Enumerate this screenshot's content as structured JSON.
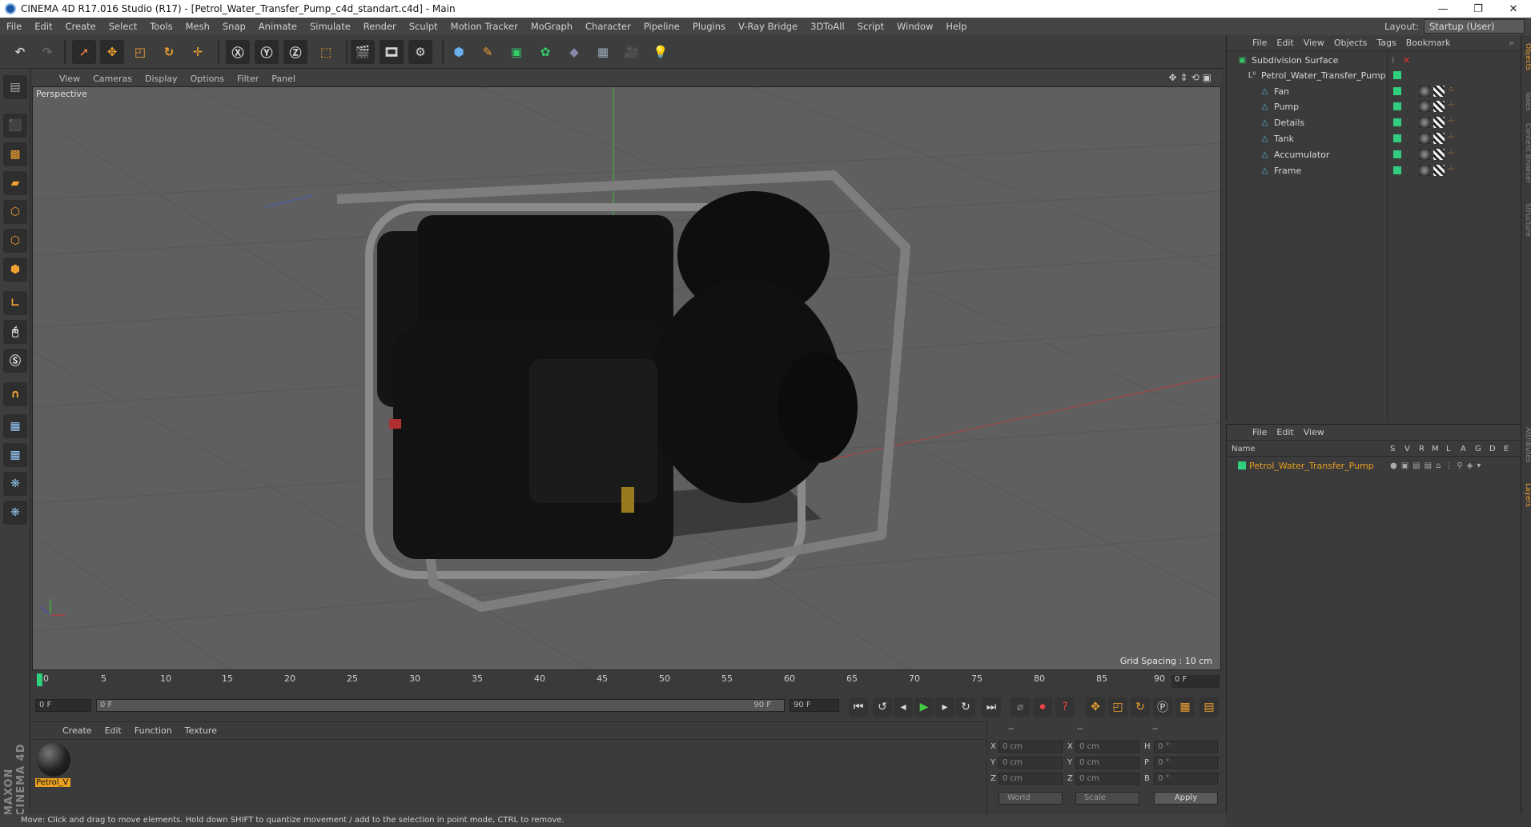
{
  "window": {
    "title": "CINEMA 4D R17.016 Studio (R17) - [Petrol_Water_Transfer_Pump_c4d_standart.c4d] - Main"
  },
  "menu": [
    "File",
    "Edit",
    "Create",
    "Select",
    "Tools",
    "Mesh",
    "Snap",
    "Animate",
    "Simulate",
    "Render",
    "Sculpt",
    "Motion Tracker",
    "MoGraph",
    "Character",
    "Pipeline",
    "Plugins",
    "V-Ray Bridge",
    "3DToAll",
    "Script",
    "Window",
    "Help"
  ],
  "layout": {
    "label": "Layout:",
    "value": "Startup (User)"
  },
  "viewport": {
    "menu": [
      "View",
      "Cameras",
      "Display",
      "Options",
      "Filter",
      "Panel"
    ],
    "label": "Perspective",
    "grid_spacing": "Grid Spacing : 10 cm"
  },
  "timeline": {
    "ticks": [
      "0",
      "5",
      "10",
      "15",
      "20",
      "25",
      "30",
      "35",
      "40",
      "45",
      "50",
      "55",
      "60",
      "65",
      "70",
      "75",
      "80",
      "85",
      "90"
    ],
    "current_frame": "0 F",
    "start_field": "0 F",
    "range_start": "0 F",
    "range_end": "90 F",
    "end_field": "90 F"
  },
  "material_manager": {
    "menu": [
      "Create",
      "Edit",
      "Function",
      "Texture"
    ],
    "materials": [
      {
        "name": "Petrol_V"
      }
    ]
  },
  "coordinates": {
    "header": [
      "--",
      "--",
      "--"
    ],
    "rows": [
      {
        "pos_label": "X",
        "pos": "0 cm",
        "size_label": "X",
        "size": "0 cm",
        "rot_label": "H",
        "rot": "0 °"
      },
      {
        "pos_label": "Y",
        "pos": "0 cm",
        "size_label": "Y",
        "size": "0 cm",
        "rot_label": "P",
        "rot": "0 °"
      },
      {
        "pos_label": "Z",
        "pos": "0 cm",
        "size_label": "Z",
        "size": "0 cm",
        "rot_label": "B",
        "rot": "0 °"
      }
    ],
    "mode": "World",
    "size_mode": "Scale",
    "apply": "Apply"
  },
  "object_manager": {
    "menu": [
      "File",
      "Edit",
      "View",
      "Objects",
      "Tags",
      "Bookmark"
    ],
    "objects": [
      {
        "name": "Subdivision Surface",
        "level": 0
      },
      {
        "name": "Petrol_Water_Transfer_Pump",
        "level": 1
      },
      {
        "name": "Fan",
        "level": 2
      },
      {
        "name": "Pump",
        "level": 2
      },
      {
        "name": "Details",
        "level": 2
      },
      {
        "name": "Tank",
        "level": 2
      },
      {
        "name": "Accumulator",
        "level": 2
      },
      {
        "name": "Frame",
        "level": 2
      }
    ]
  },
  "layer_manager": {
    "menu": [
      "File",
      "Edit",
      "View"
    ],
    "columns": {
      "name": "Name",
      "flags": [
        "S",
        "V",
        "R",
        "M",
        "L",
        "A",
        "G",
        "D",
        "E"
      ]
    },
    "layers": [
      {
        "name": "Petrol_Water_Transfer_Pump",
        "color": "#2fcf7f"
      }
    ]
  },
  "right_tabs": [
    "Objects",
    "Takes",
    "Content Browser",
    "Structure",
    "Attributes",
    "Layers"
  ],
  "status": "Move: Click and drag to move elements. Hold down SHIFT to quantize movement / add to the selection in point mode, CTRL to remove.",
  "brand": "MAXON CINEMA 4D",
  "colors": {
    "accent": "#f0a030",
    "layer_green": "#2fcf7f",
    "selected_text": "#e8a020"
  }
}
